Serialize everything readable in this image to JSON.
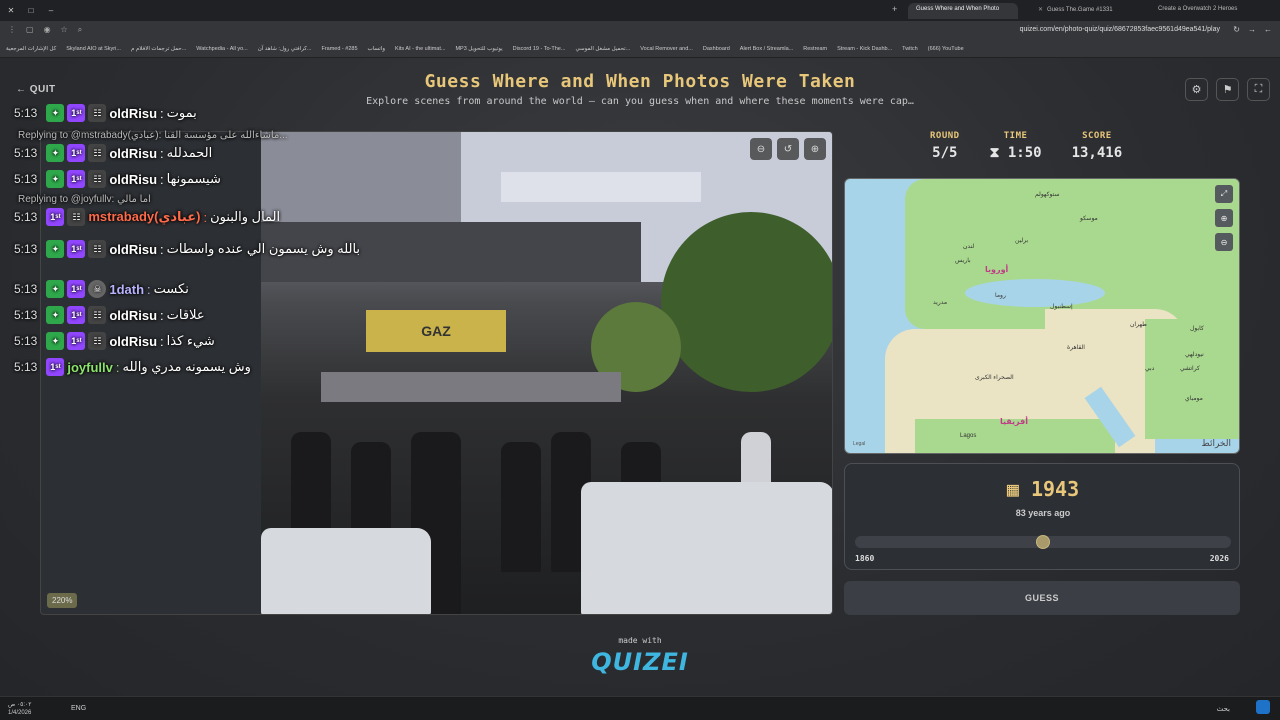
{
  "browser": {
    "tabs": [
      {
        "label": "Guess Where and When Photo",
        "active": true
      },
      {
        "label": "Guess The.Game #1331",
        "active": false
      },
      {
        "label": "Create a Overwatch 2 Heroes",
        "active": false
      }
    ],
    "url": "quizei.com/en/photo-quiz/quiz/68672853faec9561d49ea541/play",
    "bookmarks": [
      "كل الإشارات المرجعية",
      "Skyland AIO at Skyri...",
      "حمل ترجمات الافلام م...",
      "Watchpedia - All yo...",
      "كرافتي رول: شاهد آن...",
      "Framed - #285",
      "واتساب",
      "Kits AI - the ultimat...",
      "MP3 يوتيوب للتحويل",
      "Discord 19 - To-The...",
      "تحميل مشغل الموسي...",
      "Vocal Remover and...",
      "Dashboard",
      "Alert Box / Streamla...",
      "Restream",
      "Stream - Kick Dashb...",
      "Twitch",
      "(666) YouTube"
    ]
  },
  "header": {
    "quit_label": "QUIT",
    "title": "Guess Where and When Photos Were Taken",
    "subtitle": "Explore scenes from around the world — can you guess when and where these moments were cap…"
  },
  "chat": [
    {
      "time": "5:13",
      "badges": [
        "green",
        "purple",
        "mask"
      ],
      "user": "oldRisu",
      "color": "#ffffff",
      "msg": "بموت",
      "reply": ""
    },
    {
      "time": "5:13",
      "badges": [
        "green",
        "purple",
        "mask"
      ],
      "user": "oldRisu",
      "color": "#ffffff",
      "msg": "الحمدلله",
      "reply": "Replying to @mstrabady(عبادي): ماشاءالله على مؤسسة القنا..."
    },
    {
      "time": "5:13",
      "badges": [
        "green",
        "purple",
        "mask"
      ],
      "user": "oldRisu",
      "color": "#ffffff",
      "msg": "شيسمونها",
      "reply": ""
    },
    {
      "time": "5:13",
      "badges": [
        "purple",
        "mask2"
      ],
      "user": "mstrabady(عبادي)",
      "color": "#ff6a4a",
      "msg": "المال والبنون",
      "reply": "Replying to @joyfullv: اما مالي"
    },
    {
      "time": "5:13",
      "badges": [
        "green",
        "purple",
        "mask"
      ],
      "user": "oldRisu",
      "color": "#ffffff",
      "msg": "بالله وش يسمون الي عنده واسطات",
      "reply": ""
    },
    {
      "time": "5:13",
      "badges": [
        "green",
        "purple",
        "skull"
      ],
      "user": "1dath",
      "color": "#b9b3ff",
      "msg": "نكست",
      "reply": ""
    },
    {
      "time": "5:13",
      "badges": [
        "green",
        "purple",
        "mask"
      ],
      "user": "oldRisu",
      "color": "#ffffff",
      "msg": "علاقات",
      "reply": ""
    },
    {
      "time": "5:13",
      "badges": [
        "green",
        "purple",
        "mask"
      ],
      "user": "oldRisu",
      "color": "#ffffff",
      "msg": "شيء كذا",
      "reply": ""
    },
    {
      "time": "5:13",
      "badges": [
        "purple"
      ],
      "user": "joyfullv",
      "color": "#8be36b",
      "msg": "وش يسمونه مدري والله",
      "reply": ""
    }
  ],
  "photo": {
    "zoom_label": "220%",
    "sign_text": "GAZ"
  },
  "stats": {
    "round_label": "ROUND",
    "round_value": "5/5",
    "time_label": "TIME",
    "time_value": "1:50",
    "score_label": "SCORE",
    "score_value": "13,416"
  },
  "map": {
    "labels": [
      {
        "text": "ستوكهولم"
      },
      {
        "text": "موسكو"
      },
      {
        "text": "برلين"
      },
      {
        "text": "لندن"
      },
      {
        "text": "باريس"
      },
      {
        "text": "أوروبا",
        "big": true
      },
      {
        "text": "روما"
      },
      {
        "text": "مدريد"
      },
      {
        "text": "إسطنبول"
      },
      {
        "text": "طهران"
      },
      {
        "text": "كابول"
      },
      {
        "text": "القاهرة"
      },
      {
        "text": "نيودلهي"
      },
      {
        "text": "دبي"
      },
      {
        "text": "كراتشي"
      },
      {
        "text": "الصحراء الكبرى"
      },
      {
        "text": "مومباي"
      },
      {
        "text": "Lagos"
      },
      {
        "text": "أفريقيا",
        "big": true
      }
    ],
    "attribution": "الخرائط",
    "legal": "Legal"
  },
  "year": {
    "value": "1943",
    "subtitle": "83 years ago",
    "min": "1860",
    "max": "2026",
    "min_num": 1860,
    "max_num": 2026,
    "selected_num": 1943
  },
  "guess_label": "GUESS",
  "footer": {
    "made_with": "made with",
    "logo": "QUIZEI"
  },
  "taskbar": {
    "time": "٠٥:٠٢ ص",
    "date": "1/4/2026",
    "lang": "ENG",
    "search": "بحث"
  }
}
